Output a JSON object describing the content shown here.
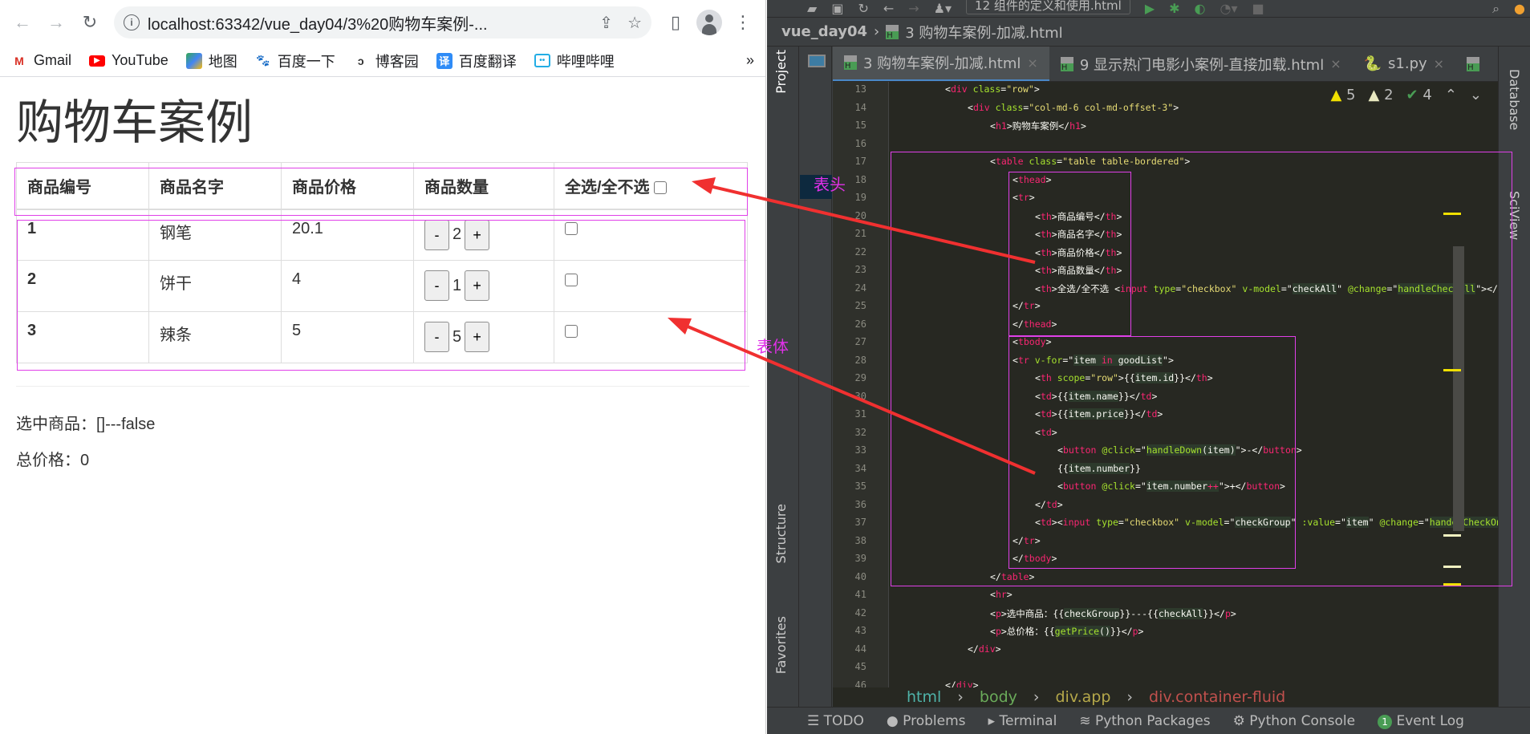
{
  "browser": {
    "url": "localhost:63342/vue_day04/3%20购物车案例-...",
    "bookmarks": [
      {
        "label": "Gmail",
        "icon": "gmail-icon"
      },
      {
        "label": "YouTube",
        "icon": "youtube-icon"
      },
      {
        "label": "地图",
        "icon": "maps-icon"
      },
      {
        "label": "百度一下",
        "icon": "baidu-icon"
      },
      {
        "label": "博客园",
        "icon": "cnblogs-icon"
      },
      {
        "label": "百度翻译",
        "icon": "baidu-translate-icon"
      },
      {
        "label": "哔哩哔哩",
        "icon": "bilibili-icon"
      }
    ],
    "more_bookmarks": "»"
  },
  "page": {
    "title": "购物车案例",
    "table": {
      "headers": [
        "商品编号",
        "商品名字",
        "商品价格",
        "商品数量",
        "全选/全不选"
      ],
      "rows": [
        {
          "id": "1",
          "name": "钢笔",
          "price": "20.1",
          "number": "2",
          "checked": false
        },
        {
          "id": "2",
          "name": "饼干",
          "price": "4",
          "number": "1",
          "checked": false
        },
        {
          "id": "3",
          "name": "辣条",
          "price": "5",
          "number": "5",
          "checked": false
        }
      ],
      "minus_label": "-",
      "plus_label": "+"
    },
    "selected_text": "选中商品：[]---false",
    "total_text": "总价格：0"
  },
  "annotations": {
    "thead_label": "表头",
    "tbody_label": "表体",
    "color": "#e030e8",
    "arrow_color": "#f03030"
  },
  "ide": {
    "run_config": "12 组件的定义和使用.html",
    "project": "vue_day04",
    "current_file": "3 购物车案例-加减.html",
    "tabs": [
      {
        "label": "3 购物车案例-加减.html",
        "active": true
      },
      {
        "label": "9 显示热门电影小案例-直接加载.html",
        "active": false
      },
      {
        "label": "s1.py",
        "active": false
      }
    ],
    "problems": {
      "warnings": "5",
      "weak_warnings": "2",
      "typos": "4"
    },
    "left_tabs": [
      "Project",
      "Structure",
      "Favorites"
    ],
    "right_tabs": [
      "Database",
      "SciView"
    ],
    "code_lines": [
      {
        "n": "13",
        "indent": 0,
        "html": "<span class='p'>&lt;</span><span class='t'>div</span> <span class='a'>class</span>=<span class='s'>\"row\"</span>&gt;"
      },
      {
        "n": "14",
        "indent": 1,
        "html": "&lt;<span class='t'>div</span> <span class='a'>class</span>=<span class='s'>\"col-md-6 col-md-offset-3\"</span>&gt;"
      },
      {
        "n": "15",
        "indent": 2,
        "html": "&lt;<span class='t'>h1</span>&gt;购物车案例&lt;/<span class='t'>h1</span>&gt;"
      },
      {
        "n": "16",
        "indent": 0,
        "html": ""
      },
      {
        "n": "17",
        "indent": 2,
        "html": "&lt;<span class='t'>table</span> <span class='a'>class</span>=<span class='s'>\"table table-bordered\"</span>&gt;"
      },
      {
        "n": "18",
        "indent": 3,
        "html": "&lt;<span class='t'>thead</span>&gt;"
      },
      {
        "n": "19",
        "indent": 3,
        "html": "&lt;<span class='t'>tr</span>&gt;"
      },
      {
        "n": "20",
        "indent": 4,
        "html": "&lt;<span class='t'>th</span>&gt;商品编号&lt;/<span class='t'>th</span>&gt;"
      },
      {
        "n": "21",
        "indent": 4,
        "html": "&lt;<span class='t'>th</span>&gt;商品名字&lt;/<span class='t'>th</span>&gt;"
      },
      {
        "n": "22",
        "indent": 4,
        "html": "&lt;<span class='t'>th</span>&gt;商品价格&lt;/<span class='t'>th</span>&gt;"
      },
      {
        "n": "23",
        "indent": 4,
        "html": "&lt;<span class='t'>th</span>&gt;商品数量&lt;/<span class='t'>th</span>&gt;"
      },
      {
        "n": "24",
        "indent": 4,
        "html": "&lt;<span class='t'>th</span>&gt;全选/全不选 &lt;<span class='t'>input</span> <span class='a'>type</span>=<span class='s'>\"checkbox\"</span> <span class='a'>v-model</span>=\"<span class='hl'>checkAll</span>\" <span class='a'>@change</span>=\"<span class='hl f'>handleCheckAll</span>\"&gt;&lt;/<span class='t'>th</span>"
      },
      {
        "n": "25",
        "indent": 3,
        "html": "&lt;/<span class='t'>tr</span>&gt;"
      },
      {
        "n": "26",
        "indent": 3,
        "html": "&lt;/<span class='t'>thead</span>&gt;"
      },
      {
        "n": "27",
        "indent": 3,
        "html": "&lt;<span class='t'>tbody</span>&gt;"
      },
      {
        "n": "28",
        "indent": 3,
        "html": "&lt;<span class='t'>tr</span> <span class='a'>v-for</span>=\"<span class='hl'>item <span class='t'>in</span> goodList</span>\"&gt;"
      },
      {
        "n": "29",
        "indent": 4,
        "html": "&lt;<span class='t'>th</span> <span class='a'>scope</span>=<span class='s'>\"row\"</span>&gt;{{<span class='hl'>item.id</span>}}&lt;/<span class='t'>th</span>&gt;"
      },
      {
        "n": "30",
        "indent": 4,
        "html": "&lt;<span class='t'>td</span>&gt;{{<span class='hl'>item.name</span>}}&lt;/<span class='t'>td</span>&gt;"
      },
      {
        "n": "31",
        "indent": 4,
        "html": "&lt;<span class='t'>td</span>&gt;{{<span class='hl'>item.price</span>}}&lt;/<span class='t'>td</span>&gt;"
      },
      {
        "n": "32",
        "indent": 4,
        "html": "&lt;<span class='t'>td</span>&gt;"
      },
      {
        "n": "33",
        "indent": 5,
        "html": "&lt;<span class='t'>button</span> <span class='a'>@click</span>=\"<span class='hl f'>handleDown</span><span class='hl'>(item)</span>\"&gt;-&lt;/<span class='t'>button</span>&gt;"
      },
      {
        "n": "34",
        "indent": 5,
        "html": "{{<span class='hl'>item.number</span>}}"
      },
      {
        "n": "35",
        "indent": 5,
        "html": "&lt;<span class='t'>button</span> <span class='a'>@click</span>=\"<span class='hl'>item.number<span class='t'>++</span></span>\"&gt;+&lt;/<span class='t'>button</span>&gt;"
      },
      {
        "n": "36",
        "indent": 4,
        "html": "&lt;/<span class='t'>td</span>&gt;"
      },
      {
        "n": "37",
        "indent": 4,
        "html": "&lt;<span class='t'>td</span>&gt;&lt;<span class='t'>input</span> <span class='a'>type</span>=<span class='s'>\"checkbox\"</span> <span class='a'>v-model</span>=\"<span class='hl'>checkGroup</span>\" <span class='a'>:value</span>=\"<span class='hl'>item</span>\" <span class='a'>@change</span>=\"<span class='hl f'>handelCheckOne</span>\""
      },
      {
        "n": "38",
        "indent": 3,
        "html": "&lt;/<span class='t'>tr</span>&gt;"
      },
      {
        "n": "39",
        "indent": 3,
        "html": "&lt;/<span class='t'>tbody</span>&gt;"
      },
      {
        "n": "40",
        "indent": 2,
        "html": "&lt;/<span class='t'>table</span>&gt;"
      },
      {
        "n": "41",
        "indent": 2,
        "html": "&lt;<span class='t'>hr</span>&gt;"
      },
      {
        "n": "42",
        "indent": 2,
        "html": "&lt;<span class='t'>p</span>&gt;选中商品：{{<span class='hl'>checkGroup</span>}}---{{<span class='hl'>checkAll</span>}}&lt;/<span class='t'>p</span>&gt;"
      },
      {
        "n": "43",
        "indent": 2,
        "html": "&lt;<span class='t'>p</span>&gt;总价格：{{<span class='hl f'>getPrice</span><span class='hl'>()</span>}}&lt;/<span class='t'>p</span>&gt;"
      },
      {
        "n": "44",
        "indent": 1,
        "html": "&lt;/<span class='t'>div</span>&gt;"
      },
      {
        "n": "45",
        "indent": 0,
        "html": ""
      },
      {
        "n": "46",
        "indent": 0,
        "html": "&lt;/<span class='t'>div</span>&gt;"
      }
    ],
    "breadcrumbs": [
      {
        "label": "html",
        "color": "#4fb3a9"
      },
      {
        "label": "body",
        "color": "#6aab5a"
      },
      {
        "label": "div.app",
        "color": "#b5a84a"
      },
      {
        "label": "div.container-fluid",
        "color": "#c0504d"
      }
    ],
    "bottom_tools": [
      "TODO",
      "Problems",
      "Terminal",
      "Python Packages",
      "Python Console",
      "Event Log"
    ],
    "event_log_count": "1"
  }
}
